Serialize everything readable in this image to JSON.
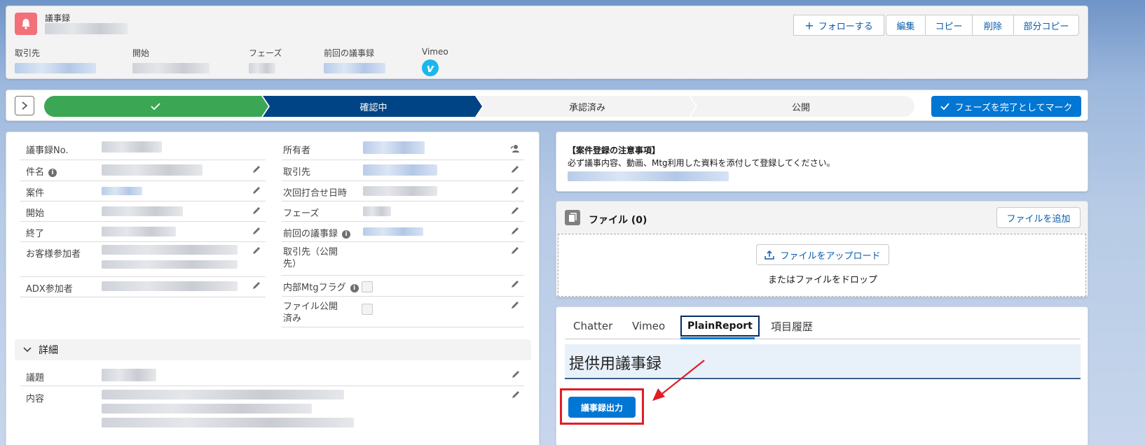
{
  "header": {
    "object_label": "議事録",
    "follow_button": "フォローする",
    "actions": [
      "編集",
      "コピー",
      "削除",
      "部分コピー"
    ],
    "highlights": [
      {
        "label": "取引先"
      },
      {
        "label": "開始"
      },
      {
        "label": "フェーズ"
      },
      {
        "label": "前回の議事録"
      },
      {
        "label": "Vimeo"
      }
    ]
  },
  "path": {
    "steps": [
      "",
      "確認中",
      "承認済み",
      "公開"
    ],
    "mark_button": "フェーズを完了としてマーク"
  },
  "details": {
    "left_fields": [
      {
        "label": "議事録No."
      },
      {
        "label": "件名"
      },
      {
        "label": "案件"
      },
      {
        "label": "開始"
      },
      {
        "label": "終了"
      },
      {
        "label": "お客様参加者"
      },
      {
        "label": "ADX参加者"
      }
    ],
    "right_fields": [
      {
        "label": "所有者"
      },
      {
        "label": "取引先"
      },
      {
        "label": "次回打合せ日時"
      },
      {
        "label": "フェーズ"
      },
      {
        "label": "前回の議事録"
      },
      {
        "label": "取引先（公開先）"
      },
      {
        "label": "内部Mtgフラグ"
      },
      {
        "label": "ファイル公開済み"
      }
    ],
    "section_title": "詳細",
    "section_fields": [
      {
        "label": "議題"
      },
      {
        "label": "内容"
      }
    ]
  },
  "notice": {
    "title": "【案件登録の注意事項】",
    "body": "必ず議事内容、動画、Mtg利用した資料を添付して登録してください。"
  },
  "files": {
    "title": "ファイル (0)",
    "add_button": "ファイルを追加",
    "upload_button": "ファイルをアップロード",
    "drop_text": "またはファイルをドロップ"
  },
  "tabs": {
    "items": [
      "Chatter",
      "Vimeo",
      "PlainReport",
      "項目履歴"
    ],
    "active": "PlainReport",
    "report_title": "提供用議事録",
    "export_button": "議事録出力"
  },
  "colors": {
    "brand": "#0176d3",
    "path_done": "#3ba755",
    "path_current": "#014486",
    "object_icon": "#f2707a",
    "highlight_red": "#e01e26"
  }
}
